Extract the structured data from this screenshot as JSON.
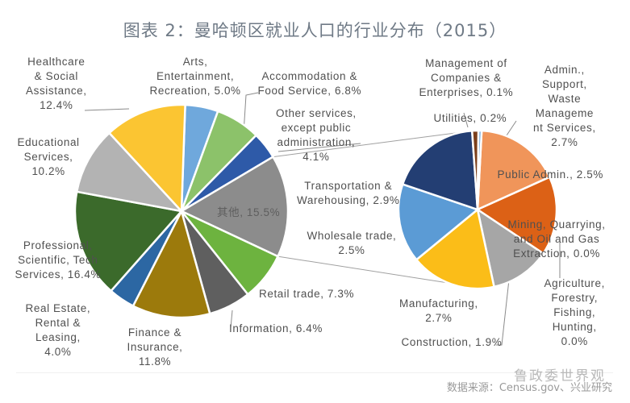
{
  "title": "图表 2：曼哈顿区就业人口的行业分布（2015）",
  "source": "数据来源：Census.gov、兴业研究",
  "watermark": "鲁政委世界观",
  "colors": {
    "arts": "#6fa8dc",
    "accommodation": "#8cc26a",
    "other_services": "#2e5aa8",
    "others_group": "#8c8c8c",
    "retail": "#6db33f",
    "information": "#5f5f5f",
    "finance": "#9c7a0c",
    "real_estate": "#2c67a3",
    "professional": "#3b6a2b",
    "educational": "#b3b3b3",
    "healthcare": "#fbc532",
    "admin_support": "#f0955a",
    "public_admin": "#dc6116",
    "mining": "#a5a5a5",
    "agriculture": "#c0c0c0",
    "construction": "#a6a6a6",
    "manufacturing": "#fbbd18",
    "wholesale": "#5b9bd5",
    "transportation": "#233e73",
    "utilities": "#7b3f1a",
    "management": "#6fa8dc"
  },
  "chart_data": [
    {
      "type": "pie",
      "name": "main",
      "title": "图表 2：曼哈顿区就业人口的行业分布（2015）",
      "unit": "%",
      "slices": [
        {
          "key": "arts",
          "label": "Arts, Entertainment, Recreation",
          "value": 5.0
        },
        {
          "key": "accommodation",
          "label": "Accommodation & Food Service",
          "value": 6.8
        },
        {
          "key": "other_services",
          "label": "Other services, except public administration",
          "value": 4.1
        },
        {
          "key": "others_group",
          "label": "其他",
          "value": 15.5
        },
        {
          "key": "retail",
          "label": "Retail trade",
          "value": 7.3
        },
        {
          "key": "information",
          "label": "Information",
          "value": 6.4
        },
        {
          "key": "finance",
          "label": "Finance & Insurance",
          "value": 11.8
        },
        {
          "key": "real_estate",
          "label": "Real Estate, Rental & Leasing",
          "value": 4.0
        },
        {
          "key": "professional",
          "label": "Professional, Scientific, Technical Services",
          "value": 16.4
        },
        {
          "key": "educational",
          "label": "Educational Services",
          "value": 10.2
        },
        {
          "key": "healthcare",
          "label": "Healthcare & Social Assistance",
          "value": 12.4
        }
      ]
    },
    {
      "type": "pie",
      "name": "breakdown-of-others",
      "unit": "%",
      "slices": [
        {
          "key": "admin_support",
          "label": "Admin., Support, Waste Management Services",
          "value": 2.7
        },
        {
          "key": "public_admin",
          "label": "Public Admin.",
          "value": 2.5
        },
        {
          "key": "mining",
          "label": "Mining, Quarrying, and Oil and Gas Extraction",
          "value": 0.0
        },
        {
          "key": "agriculture",
          "label": "Agriculture, Forestry, Fishing, Hunting",
          "value": 0.0
        },
        {
          "key": "construction",
          "label": "Construction",
          "value": 1.9
        },
        {
          "key": "manufacturing",
          "label": "Manufacturing",
          "value": 2.7
        },
        {
          "key": "wholesale",
          "label": "Wholesale trade",
          "value": 2.5
        },
        {
          "key": "transportation",
          "label": "Transportation & Warehousing",
          "value": 2.9
        },
        {
          "key": "utilities",
          "label": "Utilities",
          "value": 0.2
        },
        {
          "key": "management",
          "label": "Management of Companies & Enterprises",
          "value": 0.1
        }
      ]
    }
  ],
  "labels": {
    "healthcare": [
      "Healthcare",
      "& Social",
      "Assistance,",
      "12.4%"
    ],
    "arts": [
      "Arts,",
      "Entertainment,",
      "Recreation, 5.0%"
    ],
    "accommodation": [
      "Accommodation &",
      "Food Service, 6.8%"
    ],
    "other_services": [
      "Other services,",
      "except public",
      "administration,",
      "4.1%"
    ],
    "educational": [
      "Educational",
      "Services,",
      "10.2%"
    ],
    "others_group": [
      "其他, 15.5%"
    ],
    "transportation": [
      "Transportation &",
      "Warehousing, 2.9%"
    ],
    "wholesale": [
      "Wholesale trade,",
      "2.5%"
    ],
    "professional": [
      "Professional,",
      "Scientific, Tech",
      "Services, 16.4%"
    ],
    "retail": [
      "Retail trade, 7.3%"
    ],
    "real_estate": [
      "Real Estate,",
      "Rental &",
      "Leasing,",
      "4.0%"
    ],
    "finance": [
      "Finance &",
      "Insurance,",
      "11.8%"
    ],
    "information": [
      "Information, 6.4%"
    ],
    "management": [
      "Management of",
      "Companies &",
      "Enterprises, 0.1%"
    ],
    "utilities": [
      "Utilities, 0.2%"
    ],
    "admin_support": [
      "Admin.,",
      "Support,",
      "Waste",
      "Manageme",
      "nt Services,",
      "2.7%"
    ],
    "public_admin": [
      "Public Admin., 2.5%"
    ],
    "mining": [
      "Mining, Quarrying,",
      "and Oil and Gas",
      "Extraction, 0.0%"
    ],
    "agriculture": [
      "Agriculture,",
      "Forestry,",
      "Fishing,",
      "Hunting,",
      "0.0%"
    ],
    "manufacturing": [
      "Manufacturing,",
      "2.7%"
    ],
    "construction": [
      "Construction, 1.9%"
    ]
  }
}
